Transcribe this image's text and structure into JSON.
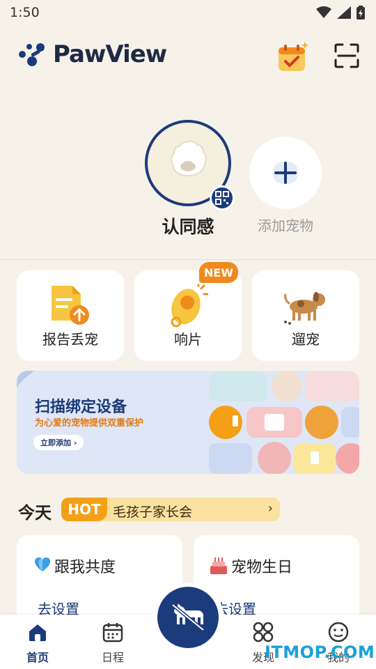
{
  "status_bar": {
    "time": "1:50"
  },
  "header": {
    "brand": "PawView",
    "icons": [
      "calendar-check-icon",
      "scan-icon"
    ]
  },
  "pets": {
    "current": {
      "name": "认同感"
    },
    "add_label": "添加宠物"
  },
  "features": [
    {
      "label": "报告丢宠",
      "icon": "report-lost-pet-icon"
    },
    {
      "label": "响片",
      "icon": "clicker-icon",
      "badge": "NEW"
    },
    {
      "label": "遛宠",
      "icon": "dog-walk-icon"
    }
  ],
  "banner": {
    "title": "扫描绑定设备",
    "subtitle": "为心爱的宠物提供双重保护",
    "button": "立即添加 ›"
  },
  "today": {
    "label": "今天",
    "hot_tag": "HOT",
    "hot_text": "毛孩子家长会",
    "hot_arrow": "›"
  },
  "cards": [
    {
      "title": "跟我共度",
      "link": "去设置",
      "icon": "heart-icon"
    },
    {
      "title": "宠物生日",
      "link": "去设置",
      "icon": "cake-icon"
    }
  ],
  "nav": {
    "items": [
      {
        "label": "首页",
        "icon": "home-icon",
        "active": true
      },
      {
        "label": "日程",
        "icon": "calendar-icon"
      },
      {
        "label": "发现",
        "icon": "discover-grid-icon"
      },
      {
        "label": "我的",
        "icon": "profile-icon"
      }
    ],
    "center_icon": "walk-dog-icon"
  },
  "watermark": "ITMOP.COM",
  "colors": {
    "primary": "#1c3b7c",
    "accent": "#f08a1c",
    "background": "#f6f2ea"
  }
}
